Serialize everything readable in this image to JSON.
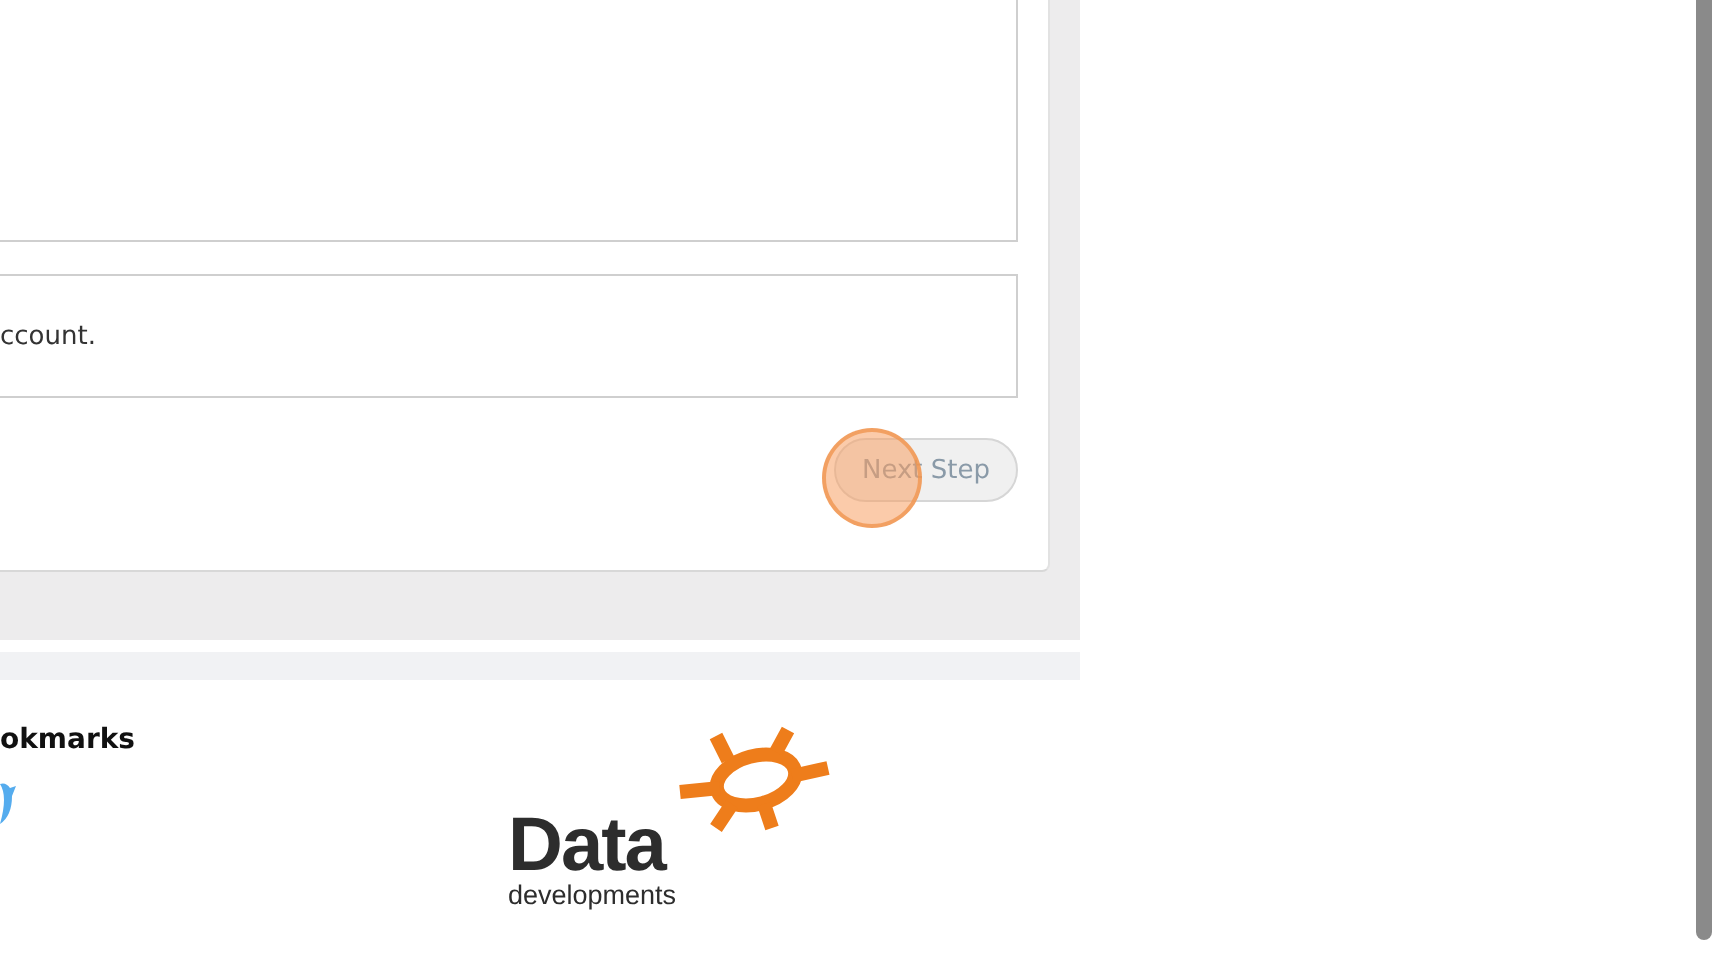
{
  "form": {
    "info_box": {
      "text": "ccount."
    },
    "next_button": {
      "label": "Next Step",
      "highlighted": true
    }
  },
  "footer": {
    "bookmarks_heading": "okmarks",
    "logo": {
      "word": "Data",
      "tagline": "developments"
    }
  }
}
